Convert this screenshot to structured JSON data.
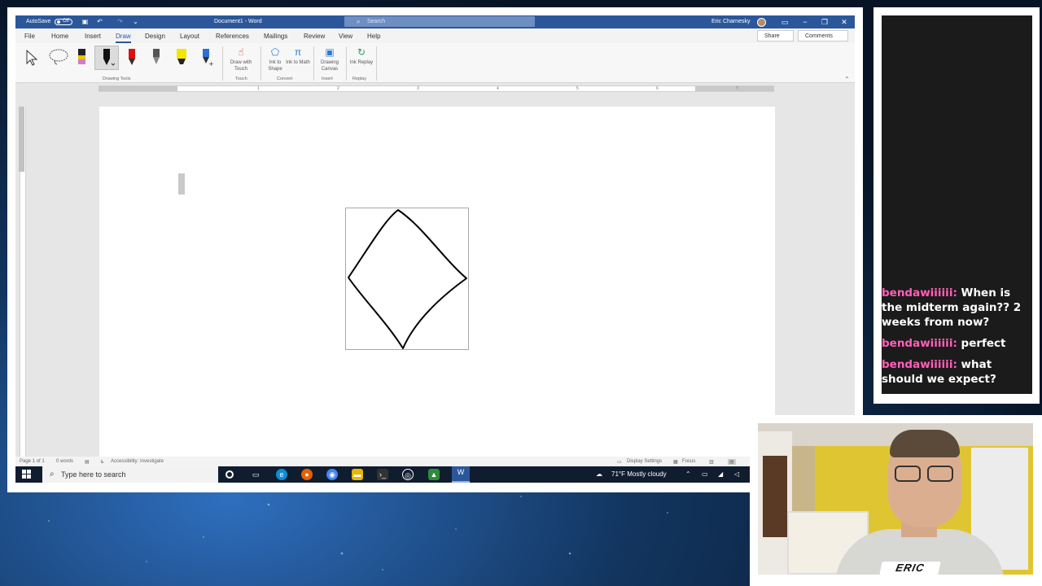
{
  "word": {
    "titlebar": {
      "autosave_label": "AutoSave",
      "autosave_state": "Off",
      "document_title": "Document1 - Word",
      "search_placeholder": "Search",
      "user_name": "Eric Charnesky"
    },
    "tabs": [
      "File",
      "Home",
      "Insert",
      "Draw",
      "Design",
      "Layout",
      "References",
      "Mailings",
      "Review",
      "View",
      "Help"
    ],
    "active_tab": "Draw",
    "share_label": "Share",
    "comments_label": "Comments",
    "ribbon": {
      "drawing_tools_label": "Drawing Tools",
      "draw_with_touch": "Draw with Touch",
      "touch_group": "Touch",
      "ink_to_shape": "Ink to Shape",
      "ink_to_math": "Ink to Math",
      "convert_group": "Convert",
      "drawing_canvas": "Drawing Canvas",
      "insert_group": "Insert",
      "ink_replay": "Ink Replay",
      "replay_group": "Replay"
    },
    "ruler_numbers": [
      "1",
      "2",
      "3",
      "4",
      "5",
      "6",
      "7"
    ],
    "statusbar": {
      "page": "Page 1 of 1",
      "words": "0 words",
      "accessibility": "Accessibility: Investigate",
      "display_settings": "Display Settings",
      "focus": "Focus"
    }
  },
  "taskbar": {
    "search_placeholder": "Type here to search",
    "weather": "71°F  Mostly cloudy"
  },
  "chat": [
    {
      "user": "bendawiiiiii:",
      "text": "When is the midterm again?? 2 weeks from now?"
    },
    {
      "user": "bendawiiiiii:",
      "text": "perfect"
    },
    {
      "user": "bendawiiiiii:",
      "text": "what should we expect?"
    }
  ],
  "webcam": {
    "name_tag": "ERIC"
  },
  "colors": {
    "word_blue": "#2b579a",
    "chat_user": "#ff5fb8",
    "chat_bg": "#1b1b1b",
    "taskbar": "#101d2f"
  }
}
